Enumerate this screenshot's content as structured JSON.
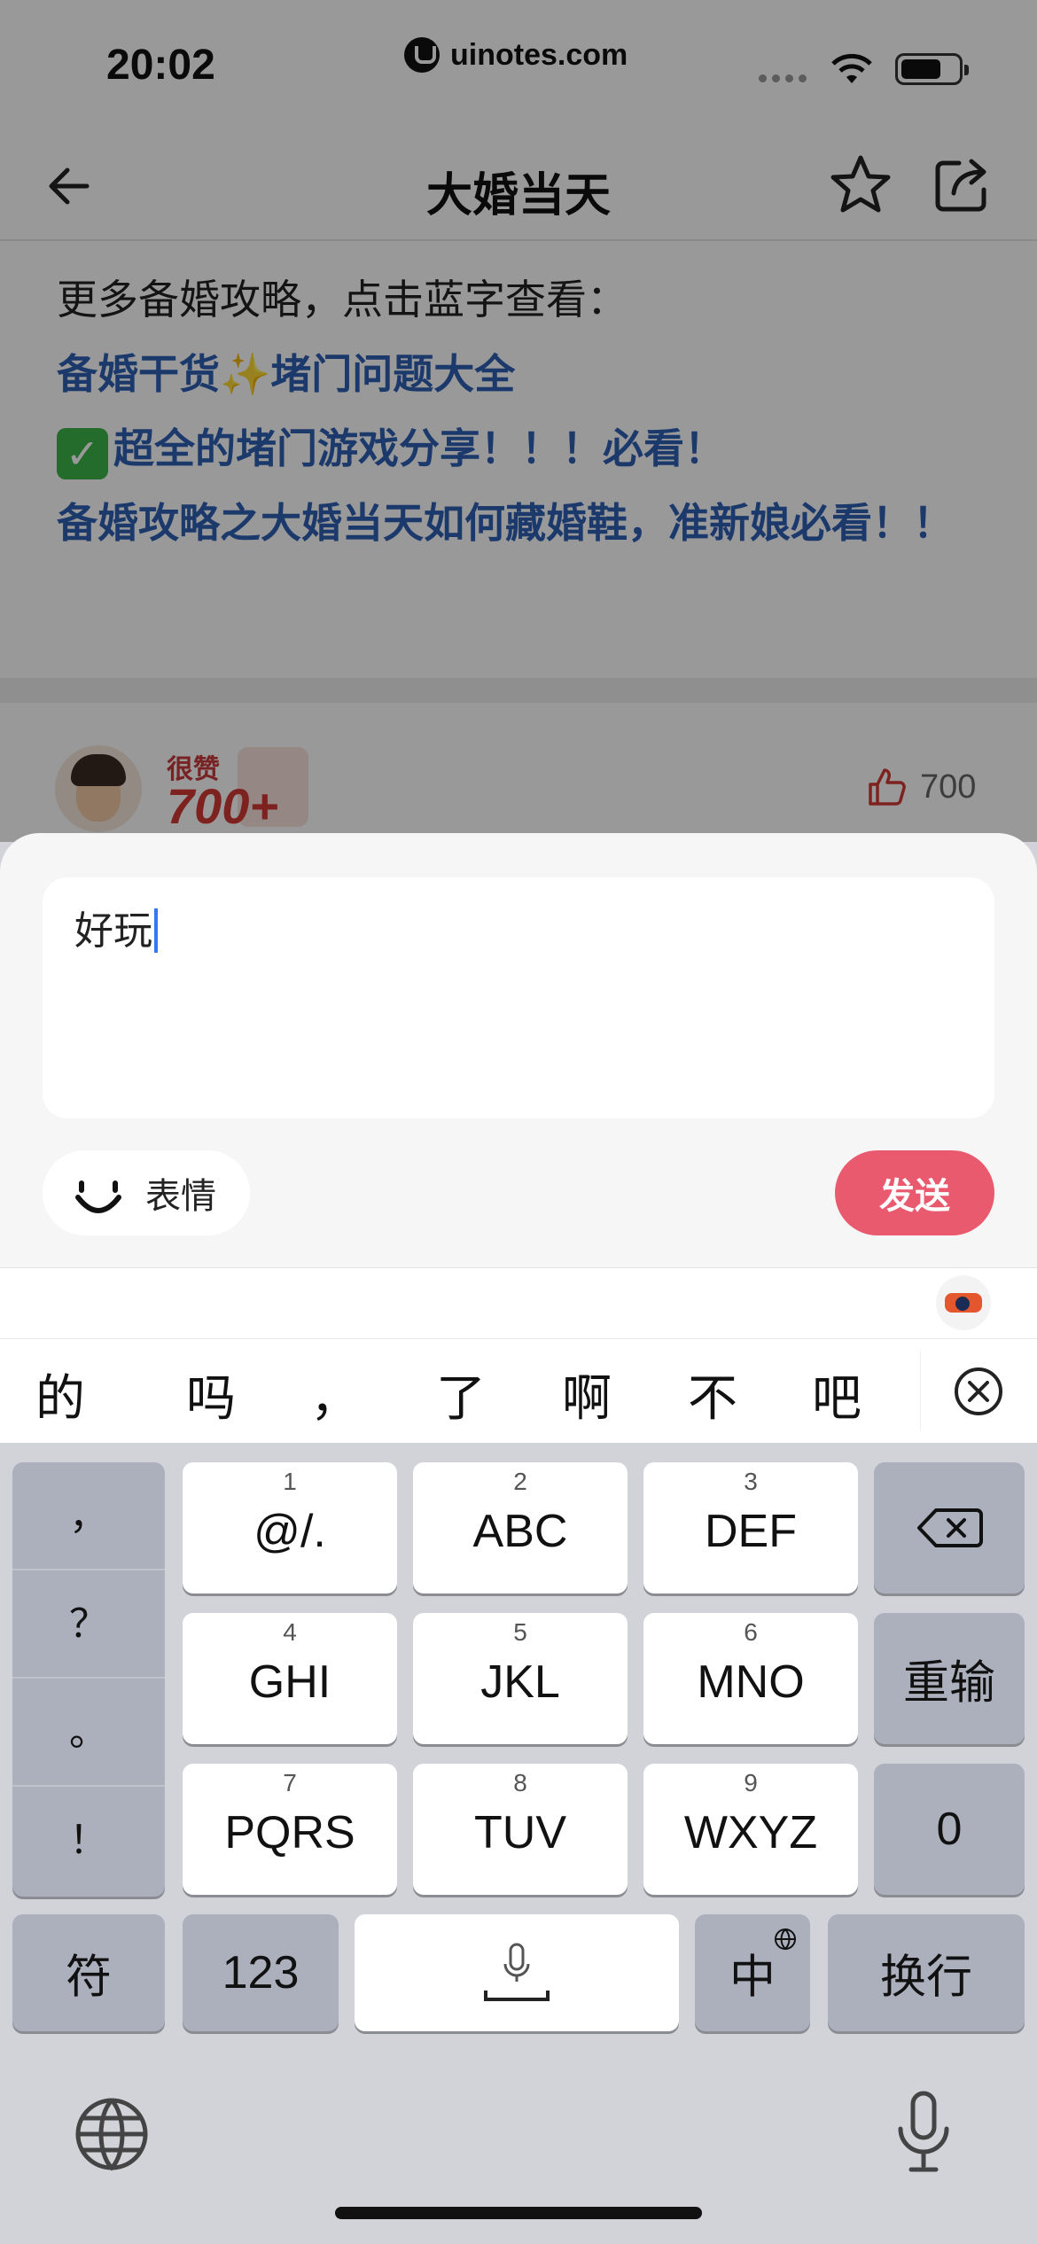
{
  "status_bar": {
    "time": "20:02",
    "url": "uinotes.com"
  },
  "nav": {
    "title": "大婚当天"
  },
  "content": {
    "intro": "更多备婚攻略，点击蓝字查看：",
    "links": [
      "备婚干货✨堵门问题大全",
      "超全的堵门游戏分享！！！必看！",
      "备婚攻略之大婚当天如何藏婚鞋，准新娘必看！！"
    ]
  },
  "comment": {
    "badge_label": "很赞",
    "badge_count": "700+",
    "like_count": "700"
  },
  "composer": {
    "input_value": "好玩",
    "emoji_label": "表情",
    "send_label": "发送"
  },
  "candidates": [
    "的",
    "吗",
    "，",
    "了",
    "啊",
    "不",
    "吧"
  ],
  "keyboard": {
    "punctuation": [
      "，",
      "？",
      "。",
      "！"
    ],
    "keys": [
      {
        "num": "1",
        "label": "@/."
      },
      {
        "num": "2",
        "label": "ABC"
      },
      {
        "num": "3",
        "label": "DEF"
      },
      {
        "num": "4",
        "label": "GHI"
      },
      {
        "num": "5",
        "label": "JKL"
      },
      {
        "num": "6",
        "label": "MNO"
      },
      {
        "num": "7",
        "label": "PQRS"
      },
      {
        "num": "8",
        "label": "TUV"
      },
      {
        "num": "9",
        "label": "WXYZ"
      }
    ],
    "reenter_label": "重输",
    "zero_label": "0",
    "symbol_label": "符",
    "numbers_label": "123",
    "lang_label": "中",
    "return_label": "换行"
  },
  "icons": [
    "back-arrow-icon",
    "star-icon",
    "share-icon",
    "thumbs-up-icon",
    "smile-icon",
    "close-circle-icon",
    "delete-icon",
    "microphone-icon",
    "globe-icon"
  ],
  "colors": {
    "link": "#2f5fb4",
    "send": "#ea5a6e",
    "caret": "#3478f6"
  }
}
